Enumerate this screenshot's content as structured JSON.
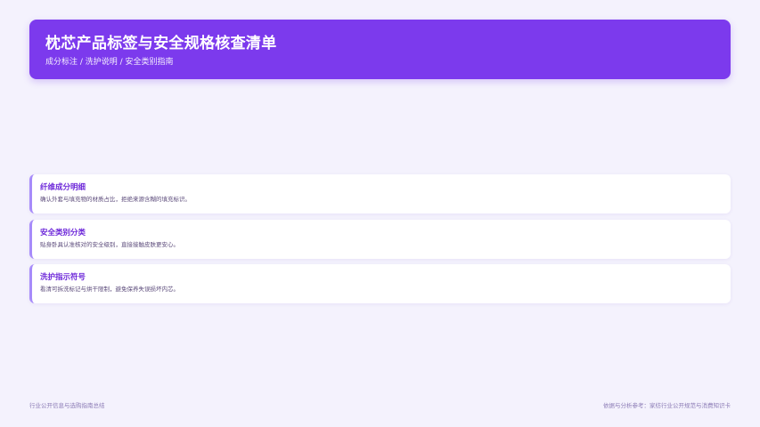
{
  "header": {
    "title": "枕芯产品标签与安全规格核查清单",
    "subtitle": "成分标注 / 洗护说明 / 安全类别指南"
  },
  "cards": [
    {
      "title": "纤维成分明细",
      "desc": "确认外套与填充物的材质占比，拒绝来源含糊的填充标识。"
    },
    {
      "title": "安全类别分类",
      "desc": "贴身卧具认准核对的安全级别，直接接触皮肤更安心。"
    },
    {
      "title": "洗护指示符号",
      "desc": "看清可拆洗标记与烘干限制，避免保养失误损坏内芯。"
    }
  ],
  "footer": {
    "left": "行业公开信息与选购指南总结",
    "right": "依据与分析参考：家纺行业公开规范与消费知识卡"
  },
  "colors": {
    "accent": "#7c3aed",
    "background": "#f4f2fd",
    "card_border": "#a78bfa",
    "card_title": "#6d28d9"
  }
}
